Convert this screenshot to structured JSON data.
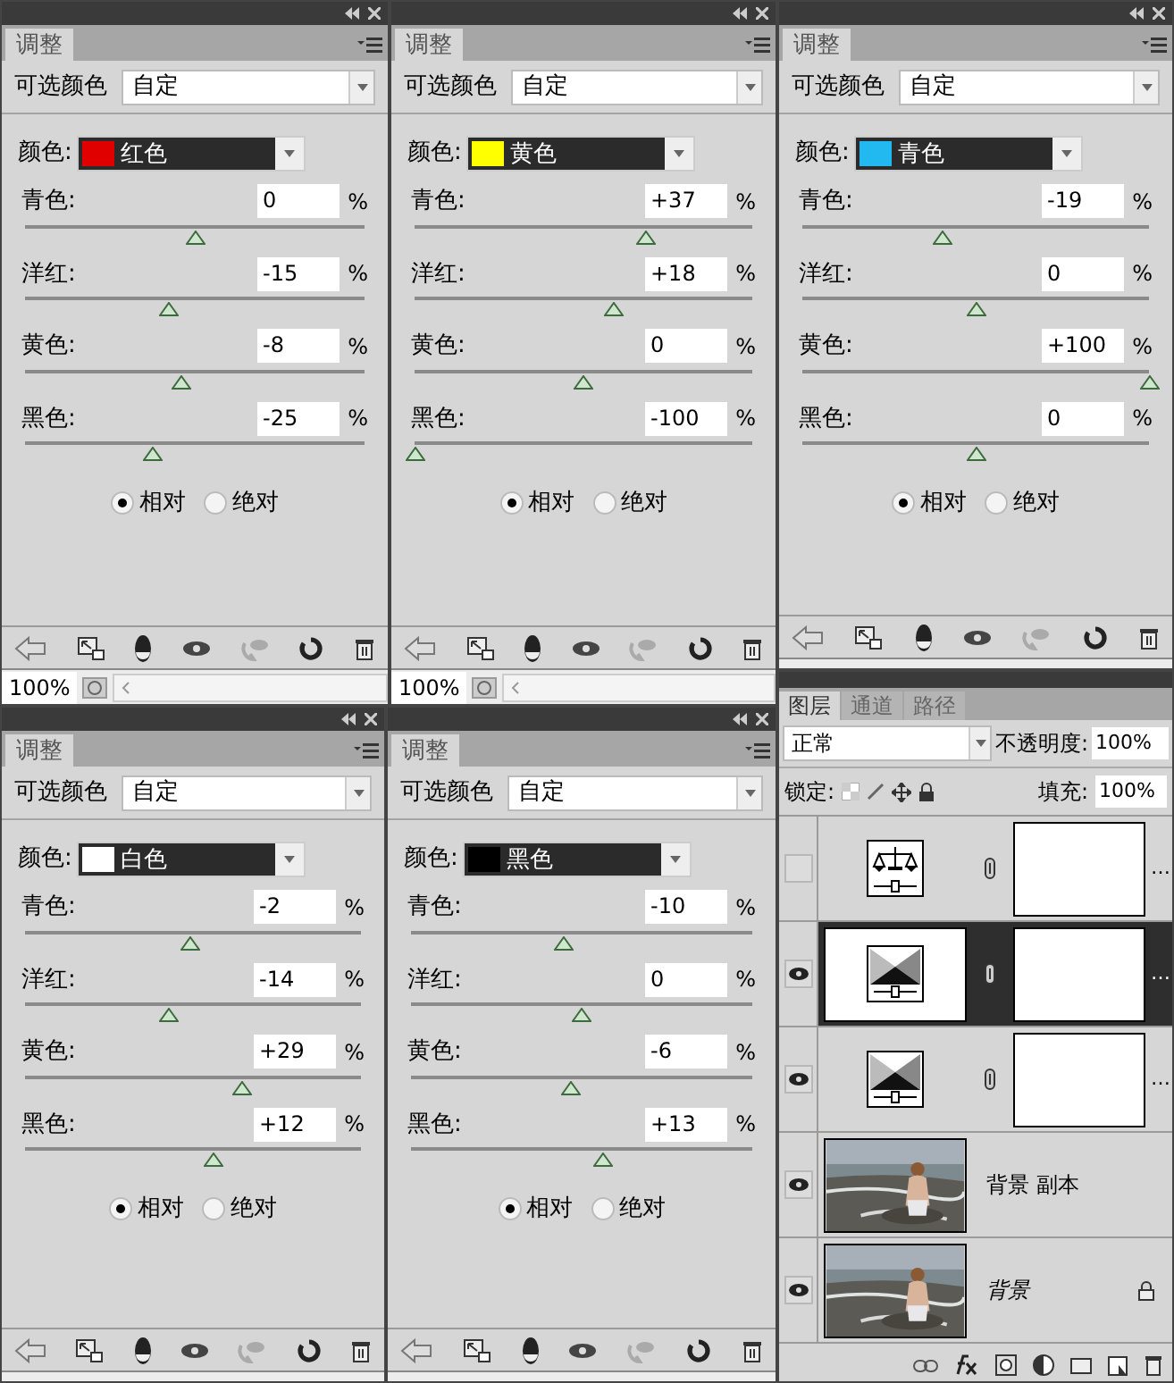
{
  "adjust_panels": [
    {
      "tab": "调整",
      "preset_label": "可选颜色",
      "preset": "自定",
      "color_label": "颜色:",
      "color": {
        "name": "红色",
        "color": "#e00000"
      },
      "sliders": [
        {
          "label": "青色:",
          "value": "0",
          "unit": "%",
          "level": 0.5
        },
        {
          "label": "洋红:",
          "value": "-15",
          "unit": "%",
          "level": 0.425
        },
        {
          "label": "黄色:",
          "value": "-8",
          "unit": "%",
          "level": 0.46
        },
        {
          "label": "黑色:",
          "value": "-25",
          "unit": "%",
          "level": 0.375
        }
      ],
      "modes": [
        {
          "label": "相对",
          "selected": true
        },
        {
          "label": "绝对",
          "selected": false
        }
      ],
      "zoom": "100%"
    },
    {
      "tab": "调整",
      "preset_label": "可选颜色",
      "preset": "自定",
      "color_label": "颜色:",
      "color": {
        "name": "黄色",
        "color": "#ffff00"
      },
      "sliders": [
        {
          "label": "青色:",
          "value": "+37",
          "unit": "%",
          "level": 0.685
        },
        {
          "label": "洋红:",
          "value": "+18",
          "unit": "%",
          "level": 0.59
        },
        {
          "label": "黄色:",
          "value": "0",
          "unit": "%",
          "level": 0.5
        },
        {
          "label": "黑色:",
          "value": "-100",
          "unit": "%",
          "level": 0
        }
      ],
      "modes": [
        {
          "label": "相对",
          "selected": true
        },
        {
          "label": "绝对",
          "selected": false
        }
      ],
      "zoom": "100%"
    },
    {
      "tab": "调整",
      "preset_label": "可选颜色",
      "preset": "自定",
      "color_label": "颜色:",
      "color": {
        "name": "青色",
        "color": "#22b8f0"
      },
      "sliders": [
        {
          "label": "青色:",
          "value": "-19",
          "unit": "%",
          "level": 0.405
        },
        {
          "label": "洋红:",
          "value": "0",
          "unit": "%",
          "level": 0.5
        },
        {
          "label": "黄色:",
          "value": "+100",
          "unit": "%",
          "level": 1
        },
        {
          "label": "黑色:",
          "value": "0",
          "unit": "%",
          "level": 0.5
        }
      ],
      "modes": [
        {
          "label": "相对",
          "selected": true
        },
        {
          "label": "绝对",
          "selected": false
        }
      ]
    },
    {
      "tab": "调整",
      "preset_label": "可选颜色",
      "preset": "自定",
      "color_label": "颜色:",
      "color": {
        "name": "白色",
        "color": "#ffffff"
      },
      "sliders": [
        {
          "label": "青色:",
          "value": "-2",
          "unit": "%",
          "level": 0.49
        },
        {
          "label": "洋红:",
          "value": "-14",
          "unit": "%",
          "level": 0.43
        },
        {
          "label": "黄色:",
          "value": "+29",
          "unit": "%",
          "level": 0.645
        },
        {
          "label": "黑色:",
          "value": "+12",
          "unit": "%",
          "level": 0.56
        }
      ],
      "modes": [
        {
          "label": "相对",
          "selected": true
        },
        {
          "label": "绝对",
          "selected": false
        }
      ]
    },
    {
      "tab": "调整",
      "preset_label": "可选颜色",
      "preset": "自定",
      "color_label": "颜色:",
      "color": {
        "name": "黑色",
        "color": "#000000"
      },
      "sliders": [
        {
          "label": "青色:",
          "value": "-10",
          "unit": "%",
          "level": 0.45
        },
        {
          "label": "洋红:",
          "value": "0",
          "unit": "%",
          "level": 0.5
        },
        {
          "label": "黄色:",
          "value": "-6",
          "unit": "%",
          "level": 0.47
        },
        {
          "label": "黑色:",
          "value": "+13",
          "unit": "%",
          "level": 0.565
        }
      ],
      "modes": [
        {
          "label": "相对",
          "selected": true
        },
        {
          "label": "绝对",
          "selected": false
        }
      ]
    }
  ],
  "layers_panel": {
    "tabs": [
      {
        "label": "图层",
        "selected": true
      },
      {
        "label": "通道",
        "selected": false
      },
      {
        "label": "路径",
        "selected": false
      }
    ],
    "blend_mode": "正常",
    "opacity_label": "不透明度:",
    "opacity": "100%",
    "lock_label": "锁定:",
    "fill_label": "填充:",
    "fill": "100%",
    "layers": [
      {
        "kind": "color_balance",
        "name": "…",
        "visible": false,
        "selected": false
      },
      {
        "kind": "selective_color",
        "name": "…",
        "visible": true,
        "selected": true
      },
      {
        "kind": "selective_color",
        "name": "…",
        "visible": true,
        "selected": false
      },
      {
        "kind": "pixel",
        "name": "背景 副本",
        "visible": true,
        "selected": false,
        "locked": false
      },
      {
        "kind": "pixel",
        "name": "背景",
        "visible": true,
        "selected": false,
        "locked": true
      }
    ]
  }
}
